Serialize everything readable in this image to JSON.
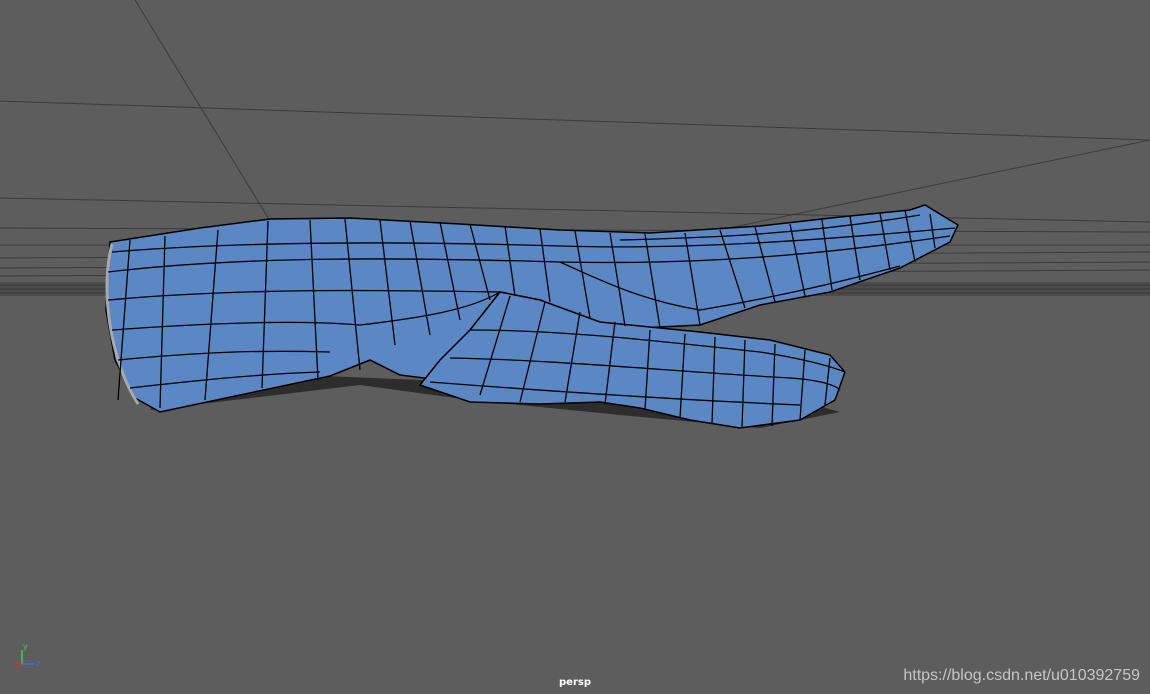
{
  "viewport": {
    "camera_label": "persp",
    "background_color": "#5d5d5d",
    "mesh_color": "#5b87c4",
    "wire_color": "#000000"
  },
  "axis_gizmo": {
    "x_label": "x",
    "y_label": "y",
    "z_label": "z",
    "x_color": "#d2342c",
    "y_color": "#52c94a",
    "z_color": "#3a6cf0"
  },
  "watermark": {
    "text": "https://blog.csdn.net/u010392759"
  }
}
